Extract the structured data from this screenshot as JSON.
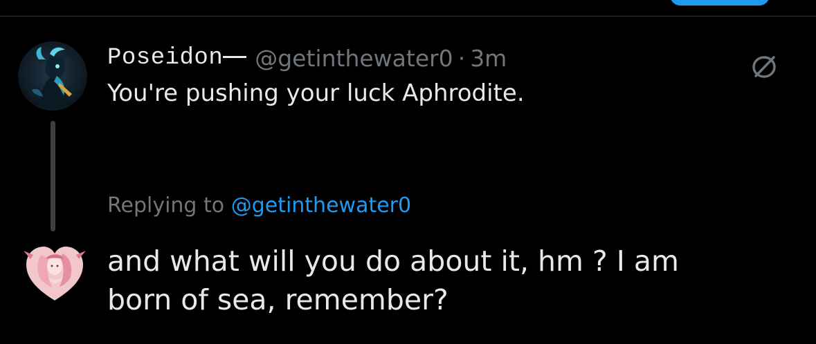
{
  "colors": {
    "background": "#000000",
    "text_primary": "#e7e9ea",
    "text_secondary": "#71767b",
    "accent": "#1d9bf0",
    "thread_line": "#3e4144"
  },
  "parent_tweet": {
    "display_name": "Poseidon",
    "handle": "@getinthewater0",
    "separator": "·",
    "time": "3m",
    "text": "You're pushing your luck Aphrodite.",
    "avatar_icon": "avatar-poseidon",
    "corner_icon": "grok-slash-icon"
  },
  "reply": {
    "replying_prefix": "Replying to",
    "replying_handle": "@getinthewater0",
    "text_line1": "and what will you do about it, hm ? I am",
    "text_line2": "born of sea, remember?",
    "avatar_icon": "avatar-aphrodite"
  }
}
